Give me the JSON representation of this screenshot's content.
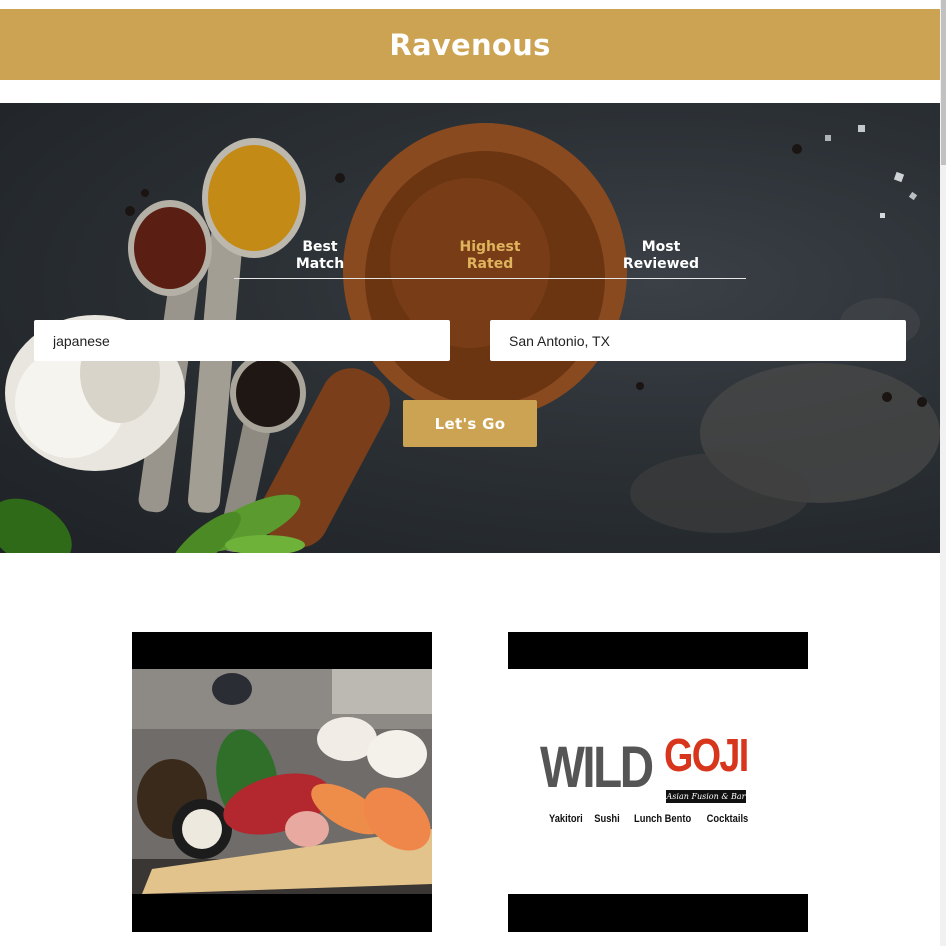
{
  "app": {
    "title": "Ravenous"
  },
  "sort_options": [
    {
      "line1": "Best",
      "line2": "Match",
      "active": false
    },
    {
      "line1": "Highest",
      "line2": "Rated",
      "active": true
    },
    {
      "line1": "Most",
      "line2": "Reviewed",
      "active": false
    }
  ],
  "search": {
    "term_value": "japanese",
    "location_value": "San Antonio, TX",
    "submit_label": "Let's Go"
  },
  "colors": {
    "brand": "#cca353",
    "active_sort": "#e0b35d",
    "goji_red": "#d8361c"
  },
  "businesses": [
    {
      "image": "sushi-platter-photo"
    },
    {
      "image": "wild-goji-logo",
      "logo": {
        "wild": "WILD",
        "goji": "GOJI",
        "tagline": "Asian Fusion & Bar",
        "menu": [
          "Yakitori",
          "Sushi",
          "Lunch Bento",
          "Cocktails"
        ]
      }
    }
  ]
}
